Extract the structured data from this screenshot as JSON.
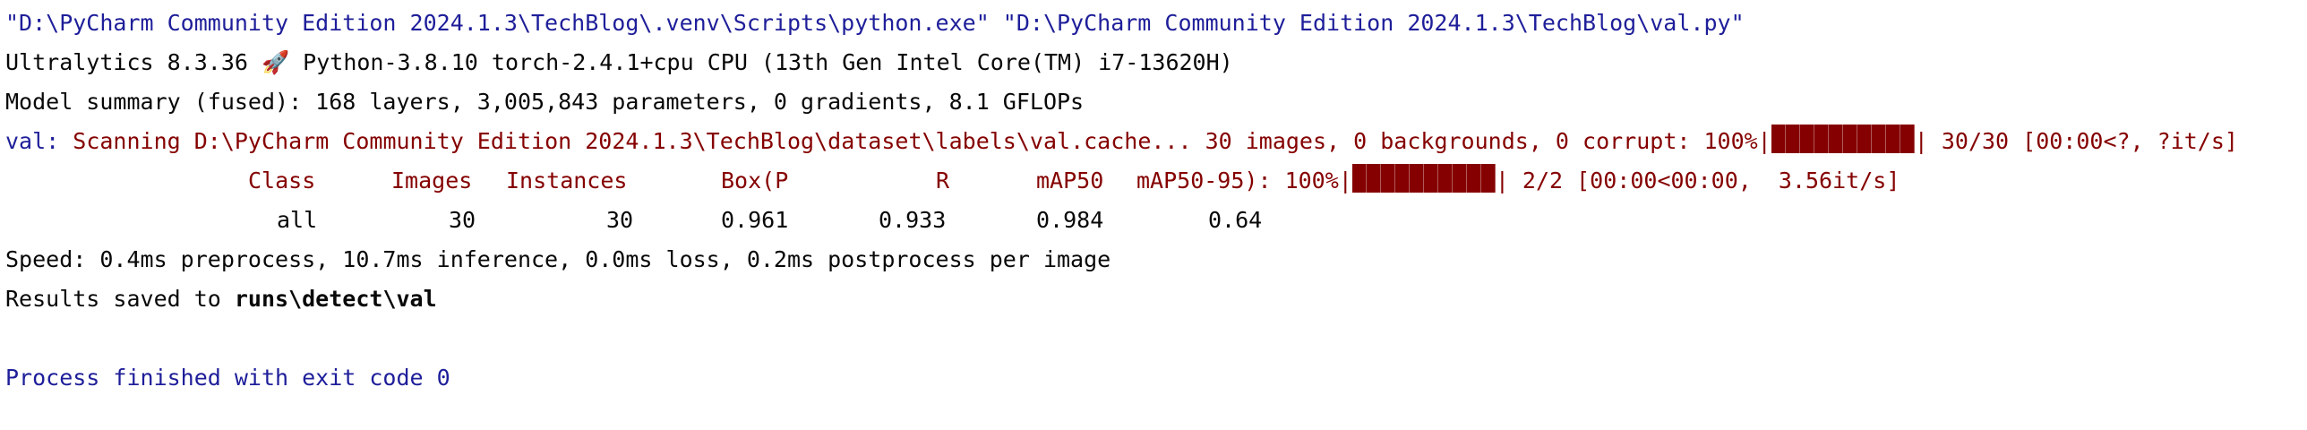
{
  "console": {
    "command": "\"D:\\PyCharm Community Edition 2024.1.3\\TechBlog\\.venv\\Scripts\\python.exe\" \"D:\\PyCharm Community Edition 2024.1.3\\TechBlog\\val.py\"",
    "env_line": {
      "before": "Ultralytics 8.3.36 ",
      "icon": "rocket-icon",
      "icon_glyph": "🚀",
      "after": " Python-3.8.10 torch-2.4.1+cpu CPU (13th Gen Intel Core(TM) i7-13620H)"
    },
    "model_summary": "Model summary (fused): 168 layers, 3,005,843 parameters, 0 gradients, 8.1 GFLOPs",
    "scan_line": {
      "prefix": "val:",
      "text": " Scanning D:\\PyCharm Community Edition 2024.1.3\\TechBlog\\dataset\\labels\\val.cache... 30 images, 0 backgrounds, 0 corrupt: 100%|",
      "progress_percent": 100,
      "suffix": "| 30/30 [00:00<?, ?it/s]"
    },
    "metrics_header": {
      "columns": [
        "Class",
        "Images",
        "Instances",
        "Box(P",
        "R",
        "mAP50",
        "mAP50-95):"
      ],
      "progress_label": " 100%|",
      "progress_percent": 100,
      "suffix": "| 2/2 [00:00<00:00,  3.56it/s]"
    },
    "metrics_row": {
      "values": [
        "all",
        "30",
        "30",
        "0.961",
        "0.933",
        "0.984",
        "0.64"
      ]
    },
    "speed": "Speed: 0.4ms preprocess, 10.7ms inference, 0.0ms loss, 0.2ms postprocess per image",
    "results": {
      "prefix": "Results saved to ",
      "path": "runs\\detect\\val"
    },
    "exit_message": "Process finished with exit code 0"
  },
  "colors": {
    "text": "#080808",
    "command_blue": "#1e1e9a",
    "error_red": "#850000",
    "background": "#ffffff"
  }
}
